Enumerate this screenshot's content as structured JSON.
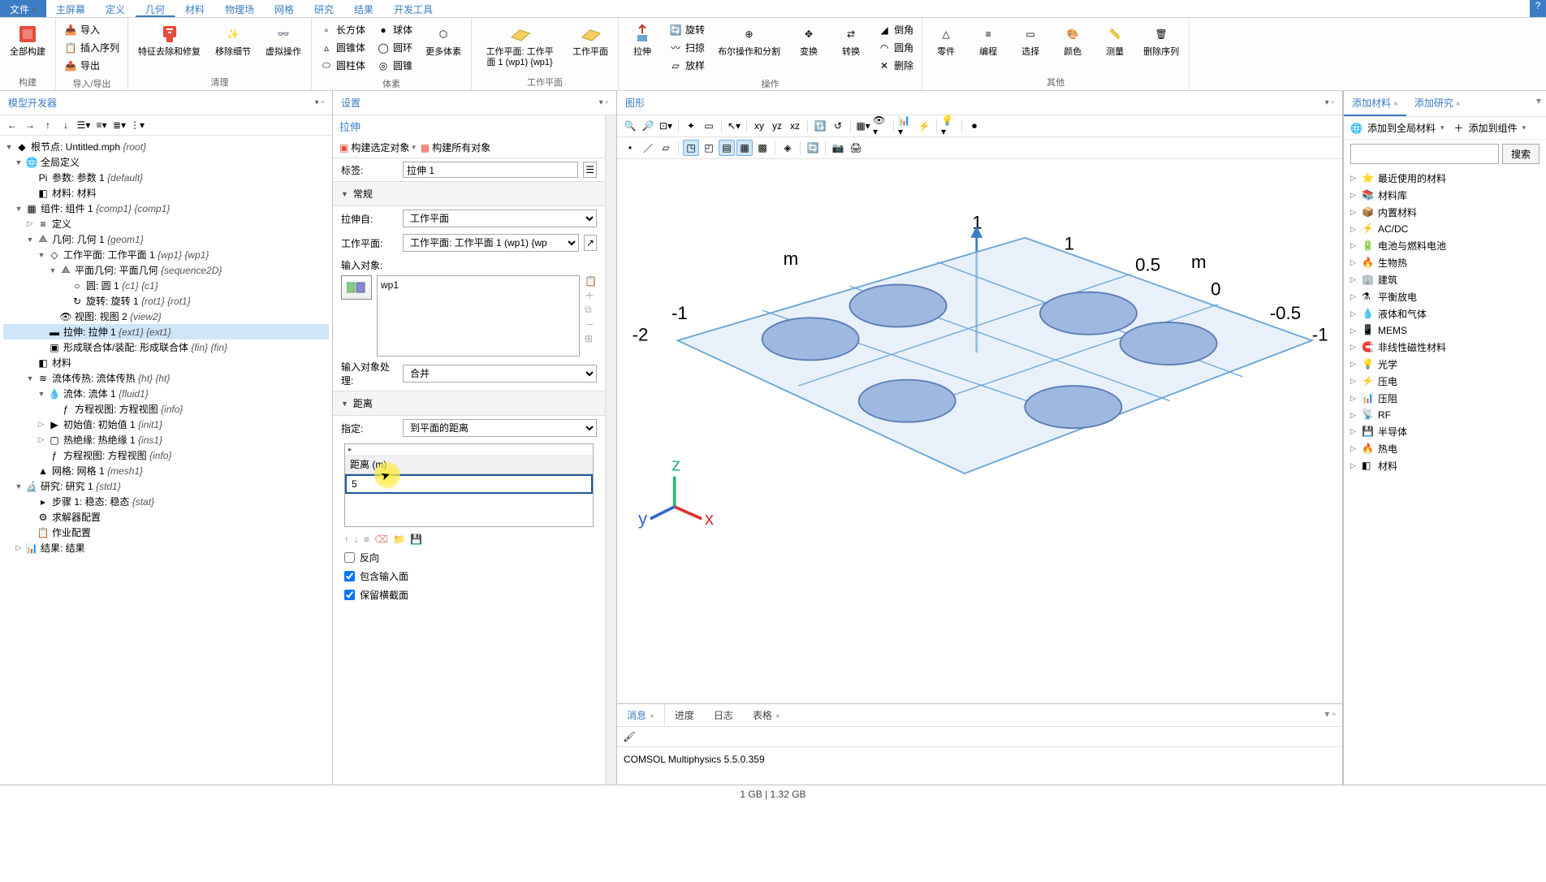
{
  "menubar": {
    "file": "文件",
    "tabs": [
      "主屏幕",
      "定义",
      "几何",
      "材料",
      "物理场",
      "网格",
      "研究",
      "结果",
      "开发工具"
    ],
    "active": 2
  },
  "ribbon": {
    "groups": [
      {
        "label": "构建",
        "buttons": [
          {
            "t": "全部构建",
            "big": true
          }
        ]
      },
      {
        "label": "导入/导出",
        "small": [
          "导入",
          "插入序列",
          "导出"
        ]
      },
      {
        "label": "清理",
        "buttons": [
          {
            "t": "特征去除和修复",
            "big": true
          },
          {
            "t": "移除细节",
            "big": true
          },
          {
            "t": "虚拟操作",
            "big": true
          }
        ]
      },
      {
        "label": "体素",
        "small": [
          "长方体",
          "圆锥体",
          "圆柱体",
          "球体",
          "圆环",
          "圆锥"
        ],
        "buttons": [
          {
            "t": "更多体素",
            "big": true
          }
        ]
      },
      {
        "label": "工作平面",
        "buttons": [
          {
            "t": "工作平面: 工作平面 1 (wp1) {wp1}",
            "big": true
          },
          {
            "t": "工作平面",
            "big": true
          }
        ]
      },
      {
        "label": "操作",
        "buttons": [
          {
            "t": "拉伸",
            "big": true
          }
        ],
        "small": [
          "旋转",
          "扫掠",
          "放样"
        ],
        "extra": [
          {
            "t": "布尔操作和分割",
            "big": true
          },
          {
            "t": "变换",
            "big": true
          },
          {
            "t": "转换",
            "big": true
          }
        ],
        "small2": [
          "倒角",
          "圆角",
          "删除"
        ]
      },
      {
        "label": "其他",
        "buttons": [
          {
            "t": "零件",
            "big": true
          },
          {
            "t": "编程",
            "big": true
          },
          {
            "t": "选择",
            "big": true
          },
          {
            "t": "颜色",
            "big": true
          },
          {
            "t": "测量",
            "big": true
          },
          {
            "t": "删除序列",
            "big": true
          }
        ]
      }
    ]
  },
  "tree": {
    "title": "模型开发器",
    "nodes": [
      {
        "d": 0,
        "exp": "▼",
        "ic": "root",
        "t": "根节点: Untitled.mph ",
        "i": "{root}"
      },
      {
        "d": 1,
        "exp": "▼",
        "ic": "globe",
        "t": "全局定义"
      },
      {
        "d": 2,
        "exp": "",
        "ic": "pi",
        "t": "参数: 参数 1 ",
        "i": "{default}"
      },
      {
        "d": 2,
        "exp": "",
        "ic": "mat",
        "t": "材料: 材料"
      },
      {
        "d": 1,
        "exp": "▼",
        "ic": "comp",
        "t": "组件: 组件 1 ",
        "i": "{comp1} {comp1}"
      },
      {
        "d": 2,
        "exp": "▷",
        "ic": "def",
        "t": "定义"
      },
      {
        "d": 2,
        "exp": "▼",
        "ic": "geom",
        "t": "几何: 几何 1 ",
        "i": "{geom1}"
      },
      {
        "d": 3,
        "exp": "▼",
        "ic": "wp",
        "t": "工作平面: 工作平面 1 ",
        "i": "{wp1} {wp1}"
      },
      {
        "d": 4,
        "exp": "▼",
        "ic": "seq",
        "t": "平面几何: 平面几何 ",
        "i": "{sequence2D}"
      },
      {
        "d": 5,
        "exp": "",
        "ic": "circ",
        "t": "圆: 圆 1 ",
        "i": "{c1} {c1}"
      },
      {
        "d": 5,
        "exp": "",
        "ic": "rot",
        "t": "旋转: 旋转 1 ",
        "i": "{rot1} {rot1}"
      },
      {
        "d": 4,
        "exp": "",
        "ic": "view",
        "t": "视图: 视图 2 ",
        "i": "{view2}"
      },
      {
        "d": 3,
        "exp": "",
        "ic": "ext",
        "t": "拉伸: 拉伸 1 ",
        "i": "{ext1} {ext1}",
        "sel": true
      },
      {
        "d": 3,
        "exp": "",
        "ic": "fin",
        "t": "形成联合体/装配: 形成联合体 ",
        "i": "{fin} {fin}"
      },
      {
        "d": 2,
        "exp": "",
        "ic": "mat",
        "t": "材料"
      },
      {
        "d": 2,
        "exp": "▼",
        "ic": "ht",
        "t": "流体传热: 流体传热 ",
        "i": "{ht} {ht}"
      },
      {
        "d": 3,
        "exp": "▼",
        "ic": "fluid",
        "t": "流体: 流体 1 ",
        "i": "{fluid1}"
      },
      {
        "d": 4,
        "exp": "",
        "ic": "eq",
        "t": "方程视图: 方程视图 ",
        "i": "{info}"
      },
      {
        "d": 3,
        "exp": "▷",
        "ic": "init",
        "t": "初始值: 初始值 1 ",
        "i": "{init1}"
      },
      {
        "d": 3,
        "exp": "▷",
        "ic": "ins",
        "t": "热绝缘: 热绝缘 1 ",
        "i": "{ins1}"
      },
      {
        "d": 3,
        "exp": "",
        "ic": "eq",
        "t": "方程视图: 方程视图 ",
        "i": "{info}"
      },
      {
        "d": 2,
        "exp": "",
        "ic": "mesh",
        "t": "网格: 网格 1 ",
        "i": "{mesh1}"
      },
      {
        "d": 1,
        "exp": "▼",
        "ic": "study",
        "t": "研究: 研究 1 ",
        "i": "{std1}"
      },
      {
        "d": 2,
        "exp": "",
        "ic": "step",
        "t": "步骤 1: 稳态: 稳态 ",
        "i": "{stat}"
      },
      {
        "d": 2,
        "exp": "",
        "ic": "solver",
        "t": "求解器配置"
      },
      {
        "d": 2,
        "exp": "",
        "ic": "job",
        "t": "作业配置"
      },
      {
        "d": 1,
        "exp": "▷",
        "ic": "result",
        "t": "结果: 结果"
      }
    ]
  },
  "settings": {
    "title": "设置",
    "sub": "拉伸",
    "build_sel": "构建选定对象",
    "build_all": "构建所有对象",
    "label_lbl": "标签:",
    "label_val": "拉伸 1",
    "sec_general": "常规",
    "extrude_from_lbl": "拉伸自:",
    "extrude_from_val": "工作平面",
    "wp_lbl": "工作平面:",
    "wp_val": "工作平面: 工作平面 1 (wp1) {wp",
    "input_obj_lbl": "输入对象:",
    "list_item": "wp1",
    "handling_lbl": "输入对象处理:",
    "handling_val": "合并",
    "sec_distance": "距离",
    "specify_lbl": "指定:",
    "specify_val": "到平面的距离",
    "dist_hdr": "距离 (m)",
    "dist_val": "5",
    "cb_reverse": "反向",
    "cb_include": "包含输入面",
    "cb_keep": "保留横截面"
  },
  "graphics": {
    "title": "图形",
    "axes": {
      "m": "m",
      "vals": [
        "1",
        "0.5",
        "0",
        "-0.5",
        "-1",
        "-2"
      ]
    },
    "coord": {
      "x": "x",
      "y": "y",
      "z": "z"
    }
  },
  "log": {
    "tabs": [
      "消息",
      "进度",
      "日志",
      "表格"
    ],
    "text": "COMSOL Multiphysics 5.5.0.359"
  },
  "right": {
    "tab1": "添加材料",
    "tab2": "添加研究",
    "add_global": "添加到全局材料",
    "add_comp": "添加到组件",
    "search_btn": "搜索",
    "materials": [
      "最近使用的材料",
      "材料库",
      "内置材料",
      "AC/DC",
      "电池与燃料电池",
      "生物热",
      "建筑",
      "平衡放电",
      "液体和气体",
      "MEMS",
      "非线性磁性材料",
      "光学",
      "压电",
      "压阻",
      "RF",
      "半导体",
      "热电",
      "材料"
    ]
  },
  "status": {
    "mem": "1 GB | 1.32 GB"
  }
}
